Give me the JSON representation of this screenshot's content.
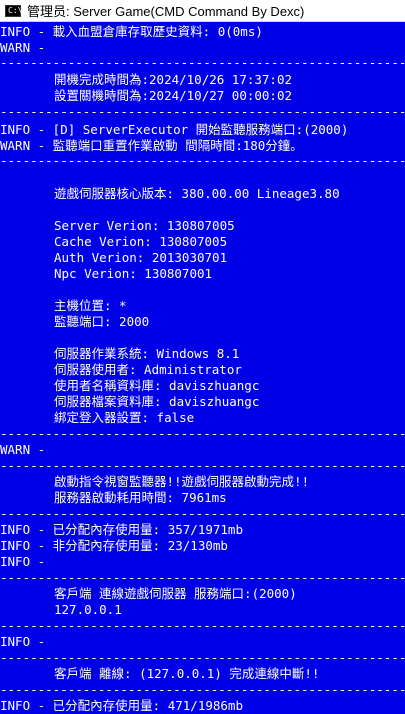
{
  "window": {
    "title": "管理员:  Server Game(CMD Command By Dexc)",
    "icon": "cmd-icon",
    "icon_glyph": "C:\\"
  },
  "console": {
    "lines": [
      "INFO - 載入血盟倉庫存取歷史資料: 0(0ms)",
      "WARN -",
      "--------------------------------------------------------------",
      "開機完成時間為:2024/10/26 17:37:02",
      "設置關機時間為:2024/10/27 00:00:02",
      "--------------------------------------------------------------",
      "INFO - [D] ServerExecutor 開始監聽服務端口:(2000)",
      "WARN - 監聽端口重置作業啟動 間隔時間:180分鐘。",
      "--------------------------------------------------------------",
      "遊戲伺服器核心版本: 380.00.00 Lineage3.80",
      "Server Verion: 130807005",
      "Cache Verion: 130807005",
      "Auth Verion: 2013030701",
      "Npc Verion: 130807001",
      "主機位置: *",
      "監聽端口: 2000",
      "伺服器作業系統: Windows 8.1",
      "伺服器使用者: Administrator",
      "使用者名稱資料庫: daviszhuangc",
      "伺服器檔案資料庫: daviszhuangc",
      "綁定登入器設置: false",
      "--------------------------------------------------------------",
      "WARN -",
      "--------------------------------------------------------------",
      "啟動指令視窗監聽器!!遊戲伺服器啟動完成!!",
      "服務器啟動耗用時間: 7961ms",
      "--------------------------------------------------------------",
      "INFO - 已分配內存使用量: 357/1971mb",
      "INFO - 非分配內存使用量: 23/130mb",
      "INFO -",
      "--------------------------------------------------------------",
      "客戶端 連線遊戲伺服器 服務端口:(2000)",
      "127.0.0.1",
      "--------------------------------------------------------------",
      "INFO -",
      "--------------------------------------------------------------",
      "客戶端 離線: (127.0.0.1) 完成連線中斷!!",
      "--------------------------------------------------------------",
      "INFO - 已分配內存使用量: 471/1986mb"
    ]
  }
}
